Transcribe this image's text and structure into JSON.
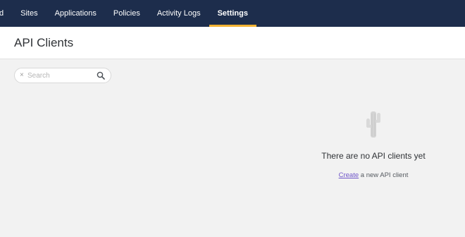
{
  "nav": {
    "items": [
      {
        "label": "d",
        "active": false
      },
      {
        "label": "Sites",
        "active": false
      },
      {
        "label": "Applications",
        "active": false
      },
      {
        "label": "Policies",
        "active": false
      },
      {
        "label": "Activity Logs",
        "active": false
      },
      {
        "label": "Settings",
        "active": true
      }
    ]
  },
  "header": {
    "title": "API Clients"
  },
  "search": {
    "clear_icon": "×",
    "placeholder": "Search",
    "value": ""
  },
  "empty_state": {
    "illustration": "cactus-icon",
    "title": "There are no API clients yet",
    "link_label": "Create",
    "link_suffix": " a new API client"
  },
  "colors": {
    "nav_background": "#1d2d4c",
    "active_underline": "#f2b233",
    "link": "#6f55c9",
    "page_background": "#f2f2f2"
  }
}
